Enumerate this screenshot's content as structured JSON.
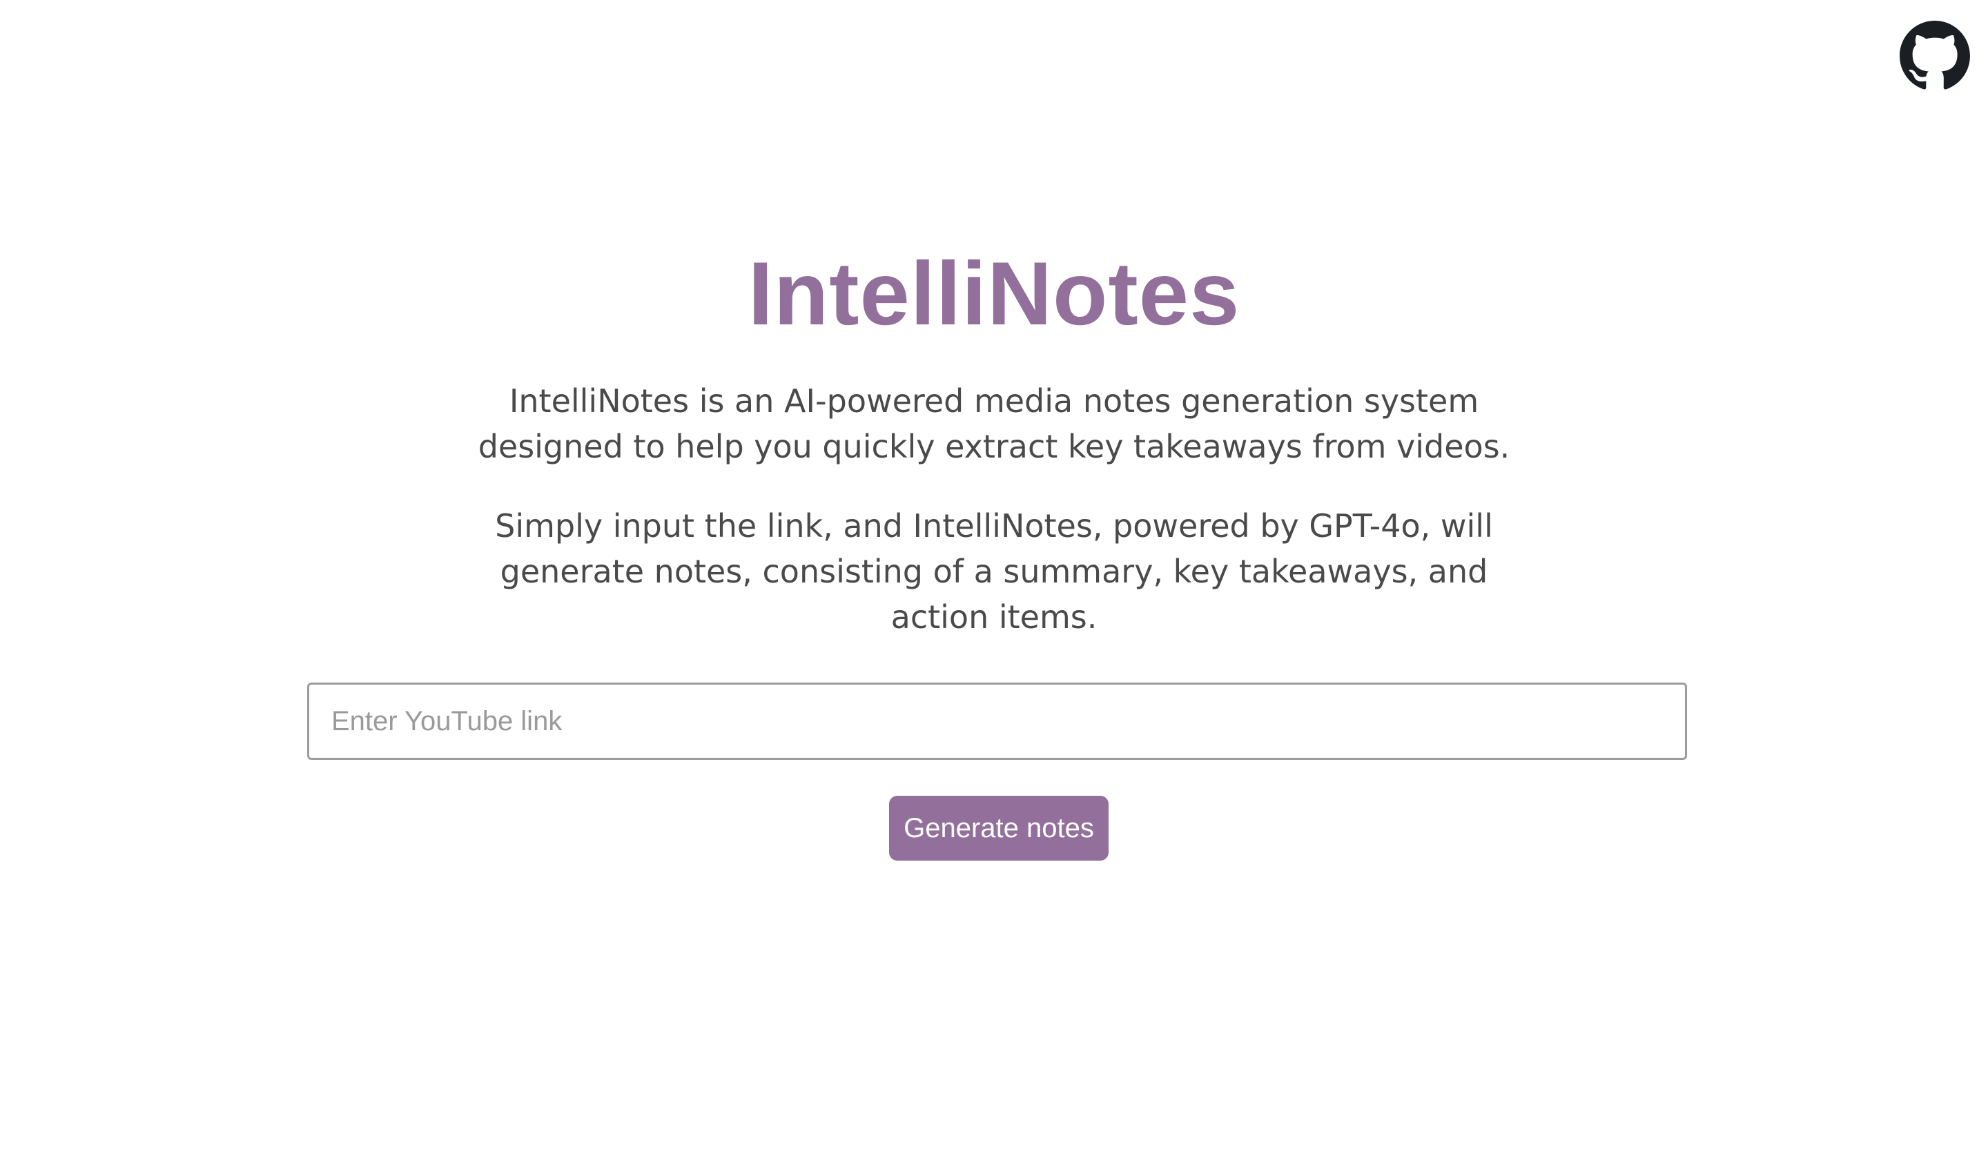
{
  "header": {
    "github_icon": "github-icon"
  },
  "hero": {
    "title": "IntelliNotes",
    "description_1": "IntelliNotes is an AI-powered media notes generation system designed to help you quickly extract key takeaways from videos.",
    "description_2": "Simply input the link, and IntelliNotes, powered by GPT-4o, will generate notes, consisting of a summary, key takeaways, and action items."
  },
  "form": {
    "link_placeholder": "Enter YouTube link",
    "link_value": "",
    "generate_label": "Generate notes"
  },
  "colors": {
    "accent": "#93709c",
    "text": "#4a4a4a",
    "background": "#ffffff"
  }
}
